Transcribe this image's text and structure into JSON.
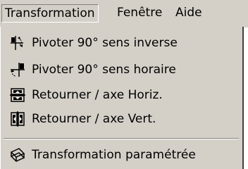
{
  "menubar": {
    "items": [
      {
        "label": "Transformation"
      },
      {
        "label": "Fenêtre"
      },
      {
        "label": "Aide"
      }
    ]
  },
  "menu": {
    "items": [
      {
        "label": "Pivoter 90° sens inverse",
        "icon": "rotate-ccw-icon"
      },
      {
        "label": "Pivoter 90° sens horaire",
        "icon": "rotate-cw-icon"
      },
      {
        "label": "Retourner / axe Horiz.",
        "icon": "flip-horizontal-axis-icon"
      },
      {
        "label": "Retourner / axe Vert.",
        "icon": "flip-vertical-axis-icon"
      },
      {
        "label": "Transformation paramétrée",
        "icon": "custom-transform-icon"
      }
    ]
  },
  "colors": {
    "menu_background": "#d4d0c8",
    "text": "#000000"
  }
}
